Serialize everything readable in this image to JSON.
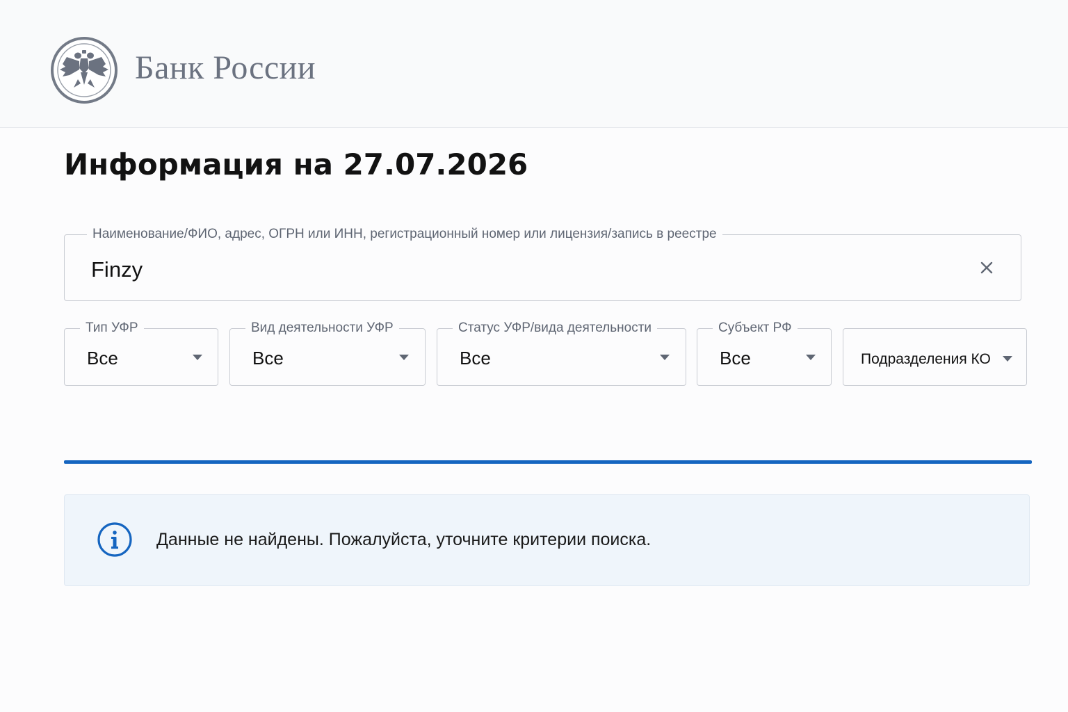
{
  "header": {
    "logo_text": "Банк России"
  },
  "page": {
    "title": "Информация на 27.07.2026"
  },
  "search": {
    "label": "Наименование/ФИО, адрес, ОГРН или ИНН, регистрационный номер или лицензия/запись в реестре",
    "value": "Finzy"
  },
  "filters": [
    {
      "label": "Тип УФР",
      "value": "Все"
    },
    {
      "label": "Вид деятельности УФР",
      "value": "Все"
    },
    {
      "label": "Статус УФР/вида деятельности",
      "value": "Все"
    },
    {
      "label": "Субъект РФ",
      "value": "Все"
    },
    {
      "label": "",
      "value": "Подразделения КО"
    }
  ],
  "notice": {
    "text": "Данные не найдены.  Пожалуйста,  уточните критерии поиска."
  },
  "colors": {
    "accent": "#1565c0",
    "notice_bg": "#eff5fb",
    "logo_grey": "#6b7280"
  },
  "icons": [
    "bank-emblem-icon",
    "clear-icon",
    "chevron-down-icon",
    "info-icon"
  ]
}
